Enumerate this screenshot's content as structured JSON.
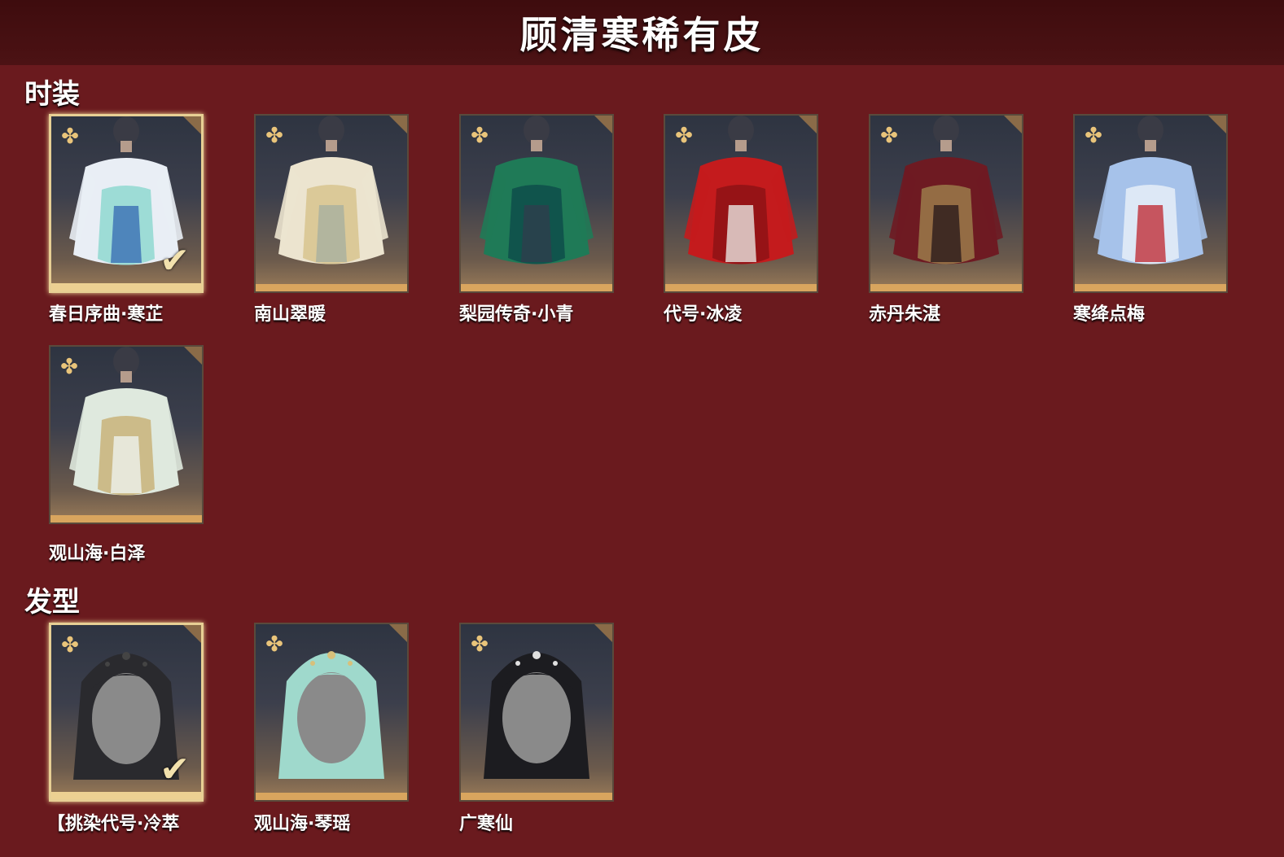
{
  "header": {
    "title": "顾清寒稀有皮"
  },
  "sections": [
    {
      "title": "时装",
      "items": [
        {
          "name": "春日序曲·寒芷",
          "selected": true,
          "palette": [
            "#e9eef5",
            "#8fd8d0",
            "#3b6fb4"
          ]
        },
        {
          "name": "南山翠暖",
          "selected": false,
          "palette": [
            "#ece4cf",
            "#d8c48e",
            "#a8b0a0"
          ]
        },
        {
          "name": "梨园传奇·小青",
          "selected": false,
          "palette": [
            "#1f7a57",
            "#0e4d4a",
            "#2e3d4c"
          ]
        },
        {
          "name": "代号·冰凌",
          "selected": false,
          "palette": [
            "#c41b1d",
            "#8e1215",
            "#e9e5e0"
          ]
        },
        {
          "name": "赤丹朱湛",
          "selected": false,
          "palette": [
            "#6e1a22",
            "#9b7b4a",
            "#2b1c1c"
          ]
        },
        {
          "name": "寒绛点梅",
          "selected": false,
          "palette": [
            "#a6c2ea",
            "#e6eef8",
            "#c0303a"
          ]
        },
        {
          "name": "观山海·白泽",
          "selected": false,
          "palette": [
            "#dfe9de",
            "#c9b37a",
            "#eef2ee"
          ]
        }
      ]
    },
    {
      "title": "发型",
      "items": [
        {
          "name": "【挑染代号·冷萃",
          "selected": true,
          "palette": [
            "#2a2a2e",
            "#8a8a8a",
            "#444"
          ]
        },
        {
          "name": "观山海·琴瑶",
          "selected": false,
          "palette": [
            "#9fd9cc",
            "#8a8a8a",
            "#d8c07a"
          ]
        },
        {
          "name": "广寒仙",
          "selected": false,
          "palette": [
            "#1c1c20",
            "#8a8a8a",
            "#e0e0e0"
          ]
        }
      ]
    }
  ],
  "icons": {
    "rarity": "flower-emblem-icon",
    "corner": "corner-tab-icon",
    "selected": "checkmark-icon"
  },
  "colors": {
    "background": "#6a1a1e",
    "header": "#431012",
    "gold": "#d9a55e",
    "selected_border": "#e7cf94"
  }
}
